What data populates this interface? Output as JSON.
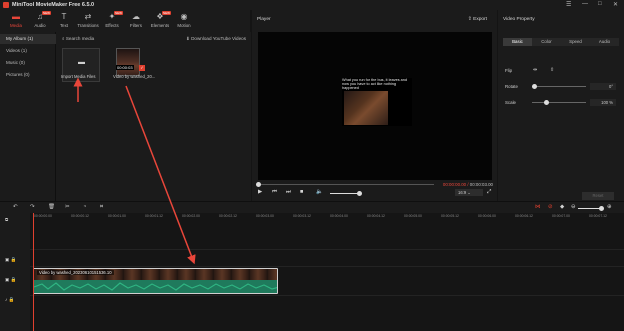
{
  "app": {
    "title": "MiniTool MovieMaker Free 6.5.0"
  },
  "toolbar": {
    "items": [
      {
        "label": "Media",
        "icon": "folder-icon",
        "active": true
      },
      {
        "label": "Audio",
        "icon": "music-note-icon",
        "badge": "NEW"
      },
      {
        "label": "Text",
        "icon": "text-icon"
      },
      {
        "label": "Transitions",
        "icon": "transition-icon"
      },
      {
        "label": "Effects",
        "icon": "effects-icon",
        "badge": "NEW"
      },
      {
        "label": "Filters",
        "icon": "filter-icon"
      },
      {
        "label": "Elements",
        "icon": "elements-icon",
        "badge": "NEW"
      },
      {
        "label": "Motion",
        "icon": "motion-icon"
      }
    ]
  },
  "leftnav": {
    "items": [
      {
        "label": "My Album (1)",
        "active": true
      },
      {
        "label": "Videos (1)"
      },
      {
        "label": "Music (0)"
      },
      {
        "label": "Pictures (0)"
      }
    ]
  },
  "media": {
    "search_label": "Search media",
    "download_label": "Download YouTube Videos",
    "import_label": "Import Media Files",
    "video_label": "Video by washed_20...",
    "video_duration": "00:00:03"
  },
  "player": {
    "header": "Player",
    "export_label": "Export",
    "caption": "What you run for the bus, it leaves and now you have to act like nothing happened",
    "time_current": "00:00:00.00",
    "time_total": "00:00:03.00",
    "ratio": "16:9"
  },
  "props": {
    "header": "Video Property",
    "tabs": [
      "Basic",
      "Color",
      "Speed",
      "Audio"
    ],
    "flip_label": "Flip",
    "rotate_label": "Rotate",
    "rotate_value": "0°",
    "scale_label": "Scale",
    "scale_value": "100 %",
    "reset_label": "Reset"
  },
  "timeline": {
    "ticks": [
      "00:00:00.00",
      "00:00:00.12",
      "00:00:01.00",
      "00:00:01.12",
      "00:00:02.00",
      "00:00:02.12",
      "00:00:03.00",
      "00:00:03.12",
      "00:00:04.00",
      "00:00:04.12",
      "00:00:05.00",
      "00:00:05.12",
      "00:00:06.00",
      "00:00:06.12",
      "00:00:07.00",
      "00:00:07.12"
    ],
    "clip_label": "Video by washed_20230610151536.10"
  },
  "colors": {
    "accent": "#e0402f",
    "audio_wave": "#1f7a5c",
    "panel": "#1b1b1b"
  }
}
